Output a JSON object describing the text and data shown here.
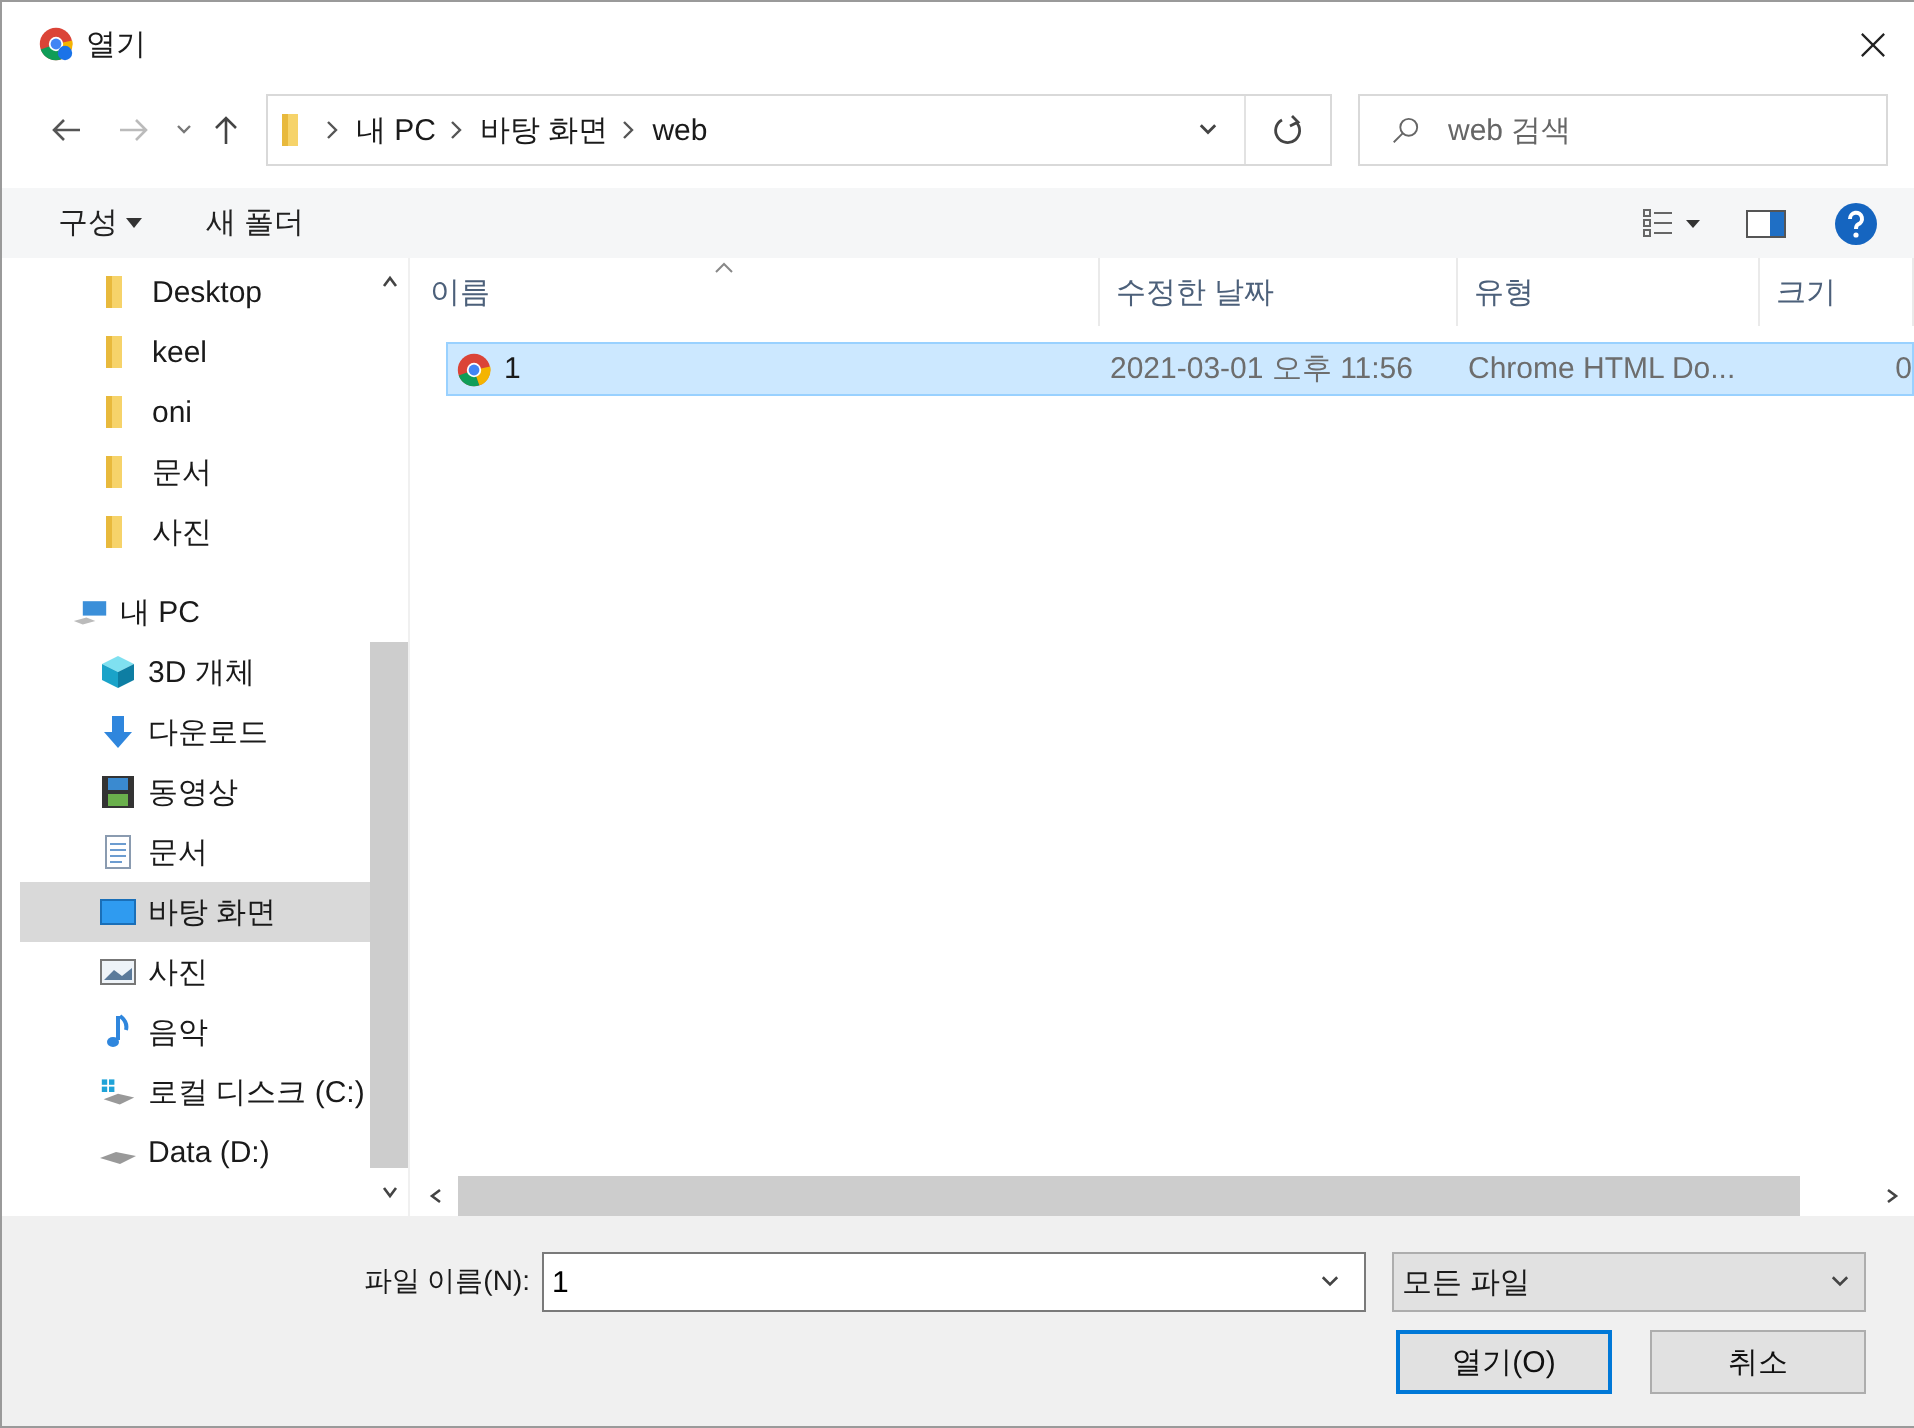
{
  "window": {
    "title": "열기"
  },
  "address_bar": {
    "crumbs": [
      "내 PC",
      "바탕 화면",
      "web"
    ]
  },
  "search": {
    "placeholder": "web 검색"
  },
  "toolbar": {
    "organize": "구성",
    "new_folder": "새 폴더"
  },
  "sidebar": {
    "quick_items": [
      {
        "label": "Desktop",
        "kind": "folder",
        "selected": false
      },
      {
        "label": "keel",
        "kind": "folder",
        "selected": false
      },
      {
        "label": "oni",
        "kind": "folder",
        "selected": false
      },
      {
        "label": "문서",
        "kind": "folder",
        "selected": false
      },
      {
        "label": "사진",
        "kind": "folder",
        "selected": false
      }
    ],
    "this_pc": {
      "label": "내 PC",
      "kind": "pc",
      "selected": false,
      "children": [
        {
          "label": "3D 개체",
          "kind": "cube",
          "selected": false
        },
        {
          "label": "다운로드",
          "kind": "download",
          "selected": false
        },
        {
          "label": "동영상",
          "kind": "video",
          "selected": false
        },
        {
          "label": "문서",
          "kind": "document",
          "selected": false
        },
        {
          "label": "바탕 화면",
          "kind": "desktop",
          "selected": true
        },
        {
          "label": "사진",
          "kind": "image",
          "selected": false
        },
        {
          "label": "음악",
          "kind": "music",
          "selected": false
        },
        {
          "label": "로컬 디스크 (C:)",
          "kind": "system_drive",
          "selected": false
        },
        {
          "label": "Data (D:)",
          "kind": "drive",
          "selected": false
        }
      ]
    }
  },
  "table": {
    "columns": [
      "이름",
      "수정한 날짜",
      "유형",
      "크기"
    ],
    "rows": [
      {
        "name": "1",
        "modified": "2021-03-01 오후 11:56",
        "type": "Chrome HTML Do...",
        "size": "0",
        "selected": true
      }
    ]
  },
  "footer": {
    "filename_label": "파일 이름(N):",
    "filename": "1",
    "filter": "모든 파일",
    "open_button": "열기(O)",
    "cancel_button": "취소"
  }
}
